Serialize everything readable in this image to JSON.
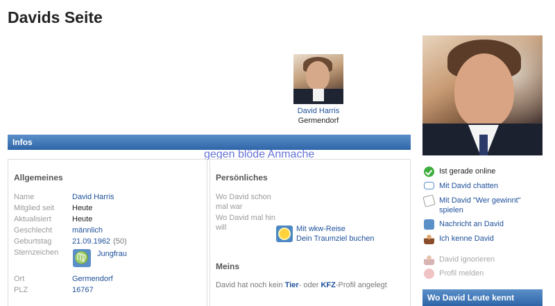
{
  "page": {
    "title": "Davids Seite"
  },
  "profile": {
    "name": "David Harris",
    "city": "Germendorf"
  },
  "watermark": "gegen blöde Anmache",
  "infos": {
    "bar_label": "Infos",
    "allgemeines": {
      "title": "Allgemeines",
      "fields": [
        {
          "label": "Name",
          "value": "David Harris"
        },
        {
          "label": "Mitglied seit",
          "value": "Heute"
        },
        {
          "label": "Aktualisiert",
          "value": "Heute"
        },
        {
          "label": "Geschlecht",
          "value": "männlich"
        },
        {
          "label": "Geburtstag",
          "value": "21.09.1962",
          "extra": "(50)"
        },
        {
          "label": "Sternzeichen",
          "value": "Jungfrau",
          "icon": "virgo-icon"
        },
        {
          "label": "Ort",
          "value": "Germendorf"
        },
        {
          "label": "PLZ",
          "value": "16767"
        }
      ]
    },
    "persoenliches": {
      "title": "Persönliches",
      "q1": "Wo David schon mal war",
      "q2": "Wo David mal hin will",
      "travel_link_line1": "Mit wkw-Reise",
      "travel_link_line2": "Dein Traumziel buchen"
    },
    "meins": {
      "title": "Meins",
      "text_prefix": "David hat noch kein ",
      "text_tier": "Tier",
      "text_mid": "- oder ",
      "text_kfz": "KFZ",
      "text_suffix": "-Profil angelegt"
    }
  },
  "actions": [
    {
      "label": "Ist gerade online",
      "icon": "online-check-icon"
    },
    {
      "label": "Mit David chatten",
      "icon": "chat-bubble-icon"
    },
    {
      "label": "Mit David \"Wer gewinnt\" spielen",
      "icon": "game-icon"
    },
    {
      "label": "Nachricht an David",
      "icon": "message-icon"
    },
    {
      "label": "Ich kenne David",
      "icon": "person-icon"
    },
    {
      "label": "David ignorieren",
      "icon": "ignore-person-icon"
    },
    {
      "label": "Profil melden",
      "icon": "report-icon"
    }
  ],
  "wo_bar": "Wo David Leute kennt",
  "colors": {
    "accent_blue": "#2f66a8",
    "link": "#1d4f9a",
    "online_green": "#3fae3f"
  }
}
